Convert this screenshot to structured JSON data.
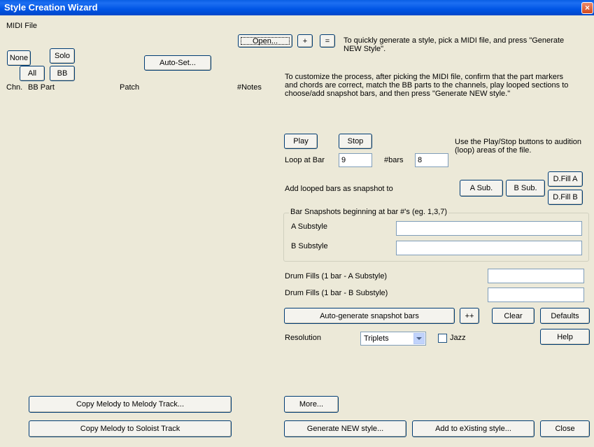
{
  "window": {
    "title": "Style Creation Wizard",
    "close_glyph": "×"
  },
  "midi": {
    "section_label": "MIDI File",
    "none": "None",
    "solo": "Solo",
    "all": "All",
    "bb": "BB",
    "auto_set": "Auto-Set...",
    "columns": {
      "chn": "Chn.",
      "bb_part": "BB Part",
      "patch": "Patch",
      "notes": "#Notes"
    }
  },
  "top": {
    "open": "Open...",
    "plus": "+",
    "equals": "=",
    "hint1": "To quickly generate a style, pick a MIDI file, and press \"Generate",
    "hint1b": "NEW Style\".",
    "hint2a": "To customize the process, after picking the MIDI file, confirm that the part markers",
    "hint2b": "and chords are correct, match the BB parts to the channels, play looped sections to",
    "hint2c": "choose/add snapshot bars, and then press \"Generate NEW style.\""
  },
  "loop": {
    "play": "Play",
    "stop": "Stop",
    "loop_label": "Loop at Bar",
    "loop_value": "9",
    "bars_label": "#bars",
    "bars_value": "8",
    "hint_a": "Use the Play/Stop buttons to audition",
    "hint_b": "(loop) areas of the file."
  },
  "snapshot": {
    "add_label": "Add  looped bars as snapshot to",
    "a_sub": "A Sub.",
    "b_sub": "B Sub.",
    "dfill_a": "D.Fill A",
    "dfill_b": "D.Fill B",
    "group_title": "Bar Snapshots beginning at bar #'s (eg. 1,3,7)",
    "a_substyle": "A Substyle",
    "b_substyle": "B Substyle",
    "a_value": "",
    "b_value": ""
  },
  "fills": {
    "drum_a": "Drum Fills (1 bar - A Substyle)",
    "drum_b": "Drum Fills (1 bar - B Substyle)",
    "drum_a_value": "",
    "drum_b_value": ""
  },
  "actions": {
    "auto_generate": "Auto-generate snapshot bars",
    "plusplus": "++",
    "clear": "Clear",
    "defaults": "Defaults",
    "resolution_label": "Resolution",
    "resolution_value": "Triplets",
    "jazz": "Jazz",
    "help": "Help"
  },
  "bottom": {
    "copy_melody": "Copy Melody to Melody Track...",
    "copy_soloist": "Copy Melody to Soloist Track",
    "more": "More...",
    "generate_new": "Generate NEW style...",
    "add_existing": "Add to eXisting style...",
    "close": "Close"
  }
}
